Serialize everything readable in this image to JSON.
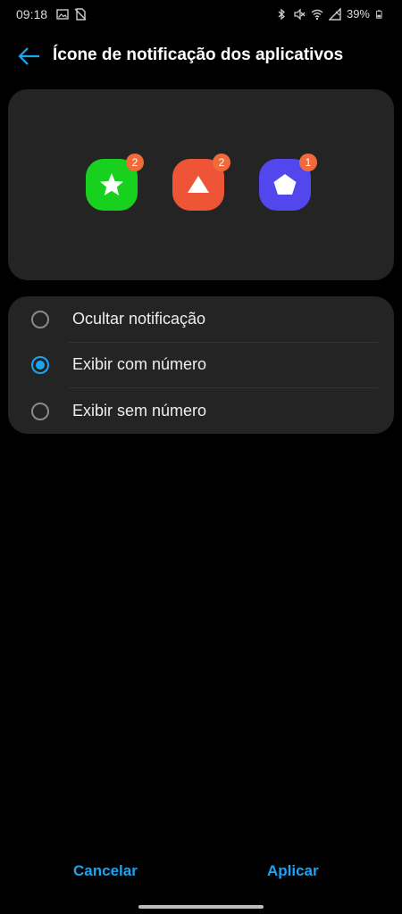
{
  "status_bar": {
    "time": "09:18",
    "battery": "39%",
    "left_icons": [
      "gallery-icon",
      "no-sim-icon"
    ],
    "right_icons": [
      "bluetooth-icon",
      "mute-icon",
      "wifi-icon",
      "signal-icon",
      "battery-icon"
    ]
  },
  "header": {
    "title": "Ícone de notificação dos aplicativos",
    "back_icon": "back-arrow-icon"
  },
  "preview": {
    "apps": [
      {
        "icon": "star-icon",
        "color": "#18d11e",
        "badge": "2"
      },
      {
        "icon": "triangle-icon",
        "color": "#ee5436",
        "badge": "2"
      },
      {
        "icon": "pentagon-icon",
        "color": "#5147ec",
        "badge": "1"
      }
    ],
    "badge_color": "#f06a3a"
  },
  "options": {
    "items": [
      {
        "label": "Ocultar notificação",
        "selected": false
      },
      {
        "label": "Exibir com número",
        "selected": true
      },
      {
        "label": "Exibir sem número",
        "selected": false
      }
    ],
    "accent": "#1ba4f2"
  },
  "actions": {
    "cancel_label": "Cancelar",
    "apply_label": "Aplicar"
  }
}
